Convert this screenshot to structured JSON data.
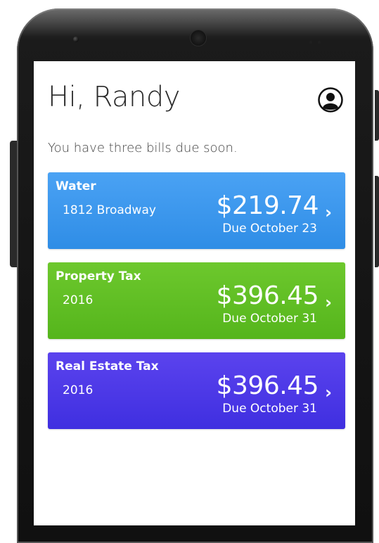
{
  "greeting": "Hi, Randy",
  "profile_icon": "account-circle-icon",
  "subtitle": "You have three bills due soon.",
  "bills": [
    {
      "name": "Water",
      "detail": "1812 Broadway",
      "amount": "$219.74",
      "due": "Due October 23",
      "color": "#3a97ec"
    },
    {
      "name": "Property Tax",
      "detail": "2016",
      "amount": "$396.45",
      "due": "Due October 31",
      "color": "#62bf25"
    },
    {
      "name": "Real Estate Tax",
      "detail": "2016",
      "amount": "$396.45",
      "due": "Due October 31",
      "color": "#4d39e8"
    }
  ],
  "chevron": "›"
}
